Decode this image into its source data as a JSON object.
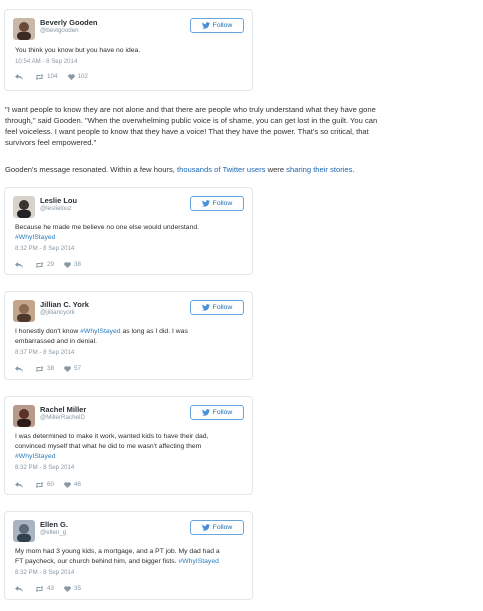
{
  "tweets": [
    {
      "name": "Beverly Gooden",
      "handle": "@bevtgooden",
      "follow_label": "Follow",
      "text_lines": [
        "You think you know but you have no idea."
      ],
      "time": "10:54 AM - 8 Sep 2014",
      "retweets": "104",
      "likes": "102",
      "avatar_color": "#6b4a3a"
    },
    {
      "name": "Leslie Lou",
      "handle": "@leslielouz",
      "follow_label": "Follow",
      "text_lines": [
        "Because he made me believe no one else would understand."
      ],
      "hashtag": "#WhyIStayed",
      "time": "8:32 PM - 8 Sep 2014",
      "retweets": "29",
      "likes": "38",
      "avatar_color": "#3a3530"
    },
    {
      "name": "Jillian C. York",
      "handle": "@jilliancyork",
      "follow_label": "Follow",
      "text_before": "I honestly don't know ",
      "hashtag": "#WhyIStayed",
      "text_after": " as long as I did. I was",
      "text_line2": "embarrassed and in denial.",
      "time": "8:37 PM - 8 Sep 2014",
      "retweets": "38",
      "likes": "57",
      "avatar_color": "#8a6a52"
    },
    {
      "name": "Rachel Miller",
      "handle": "@MillerRachelD",
      "follow_label": "Follow",
      "text_lines": [
        "I was determined to make it work, wanted kids to have their dad,",
        "convinced myself that what he did to me wasn't affecting them"
      ],
      "hashtag": "#WhyIStayed",
      "time": "8:32 PM - 8 Sep 2014",
      "retweets": "60",
      "likes": "46",
      "avatar_color": "#5a3028"
    },
    {
      "name": "Ellen G.",
      "handle": "@ellen_g",
      "follow_label": "Follow",
      "text_line1": "My mom had 3 young kids, a mortgage, and a PT job. My dad had a",
      "text_before": "FT paycheck, our church behind him, and bigger fists. ",
      "hashtag": "#WhyIStayed",
      "time": "8:32 PM - 8 Sep 2014",
      "retweets": "43",
      "likes": "35",
      "avatar_color": "#5c6a7a"
    }
  ],
  "article": {
    "quote_lines": [
      "\"I want people to know they are not alone and that there are people who truly understand what they have gone",
      "through,\" said Gooden. \"When the overwhelming public voice is of shame, you can get lost in the guilt. You can",
      "feel voiceless. I want people to know that they have a voice! That they have the power. That's so critical, that",
      "survivors feel empowered.\""
    ],
    "resonated_before": "Gooden's message resonated. Within a few hours, ",
    "link1": "thousands of Twitter users",
    "resonated_mid": " were ",
    "link2": "sharing their stories",
    "resonated_end": "."
  }
}
